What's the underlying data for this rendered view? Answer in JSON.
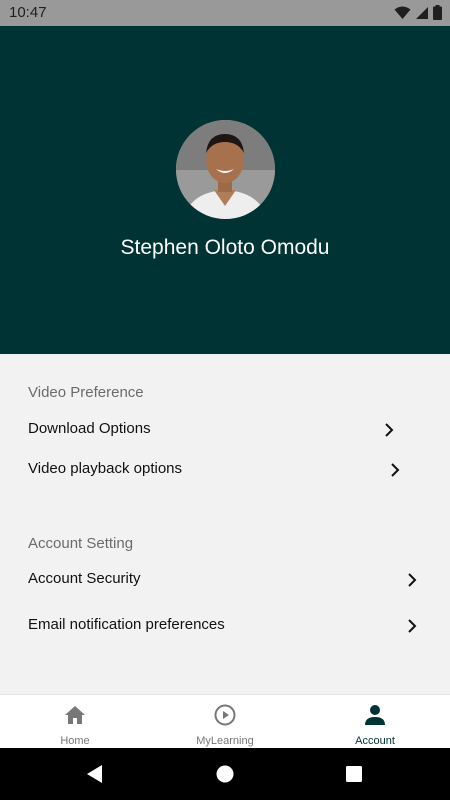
{
  "status_bar": {
    "time": "10:47",
    "icons": [
      "wifi-icon",
      "signal-icon",
      "battery-icon"
    ]
  },
  "profile": {
    "name": "Stephen Oloto Omodu",
    "header_color": "#003333"
  },
  "sections": [
    {
      "title": "Video Preference",
      "items": [
        {
          "label": "Download Options"
        },
        {
          "label": "Video playback options"
        }
      ]
    },
    {
      "title": "Account Setting",
      "items": [
        {
          "label": "Account Security"
        },
        {
          "label": "Email notification preferences"
        }
      ]
    }
  ],
  "bottom_nav": {
    "items": [
      {
        "label": "Home",
        "icon": "home-icon",
        "active": false
      },
      {
        "label": "MyLearning",
        "icon": "play-circle-icon",
        "active": false
      },
      {
        "label": "Account",
        "icon": "person-icon",
        "active": true
      }
    ]
  },
  "system_nav": {
    "buttons": [
      "back-icon",
      "home-circle-icon",
      "recents-icon"
    ]
  }
}
